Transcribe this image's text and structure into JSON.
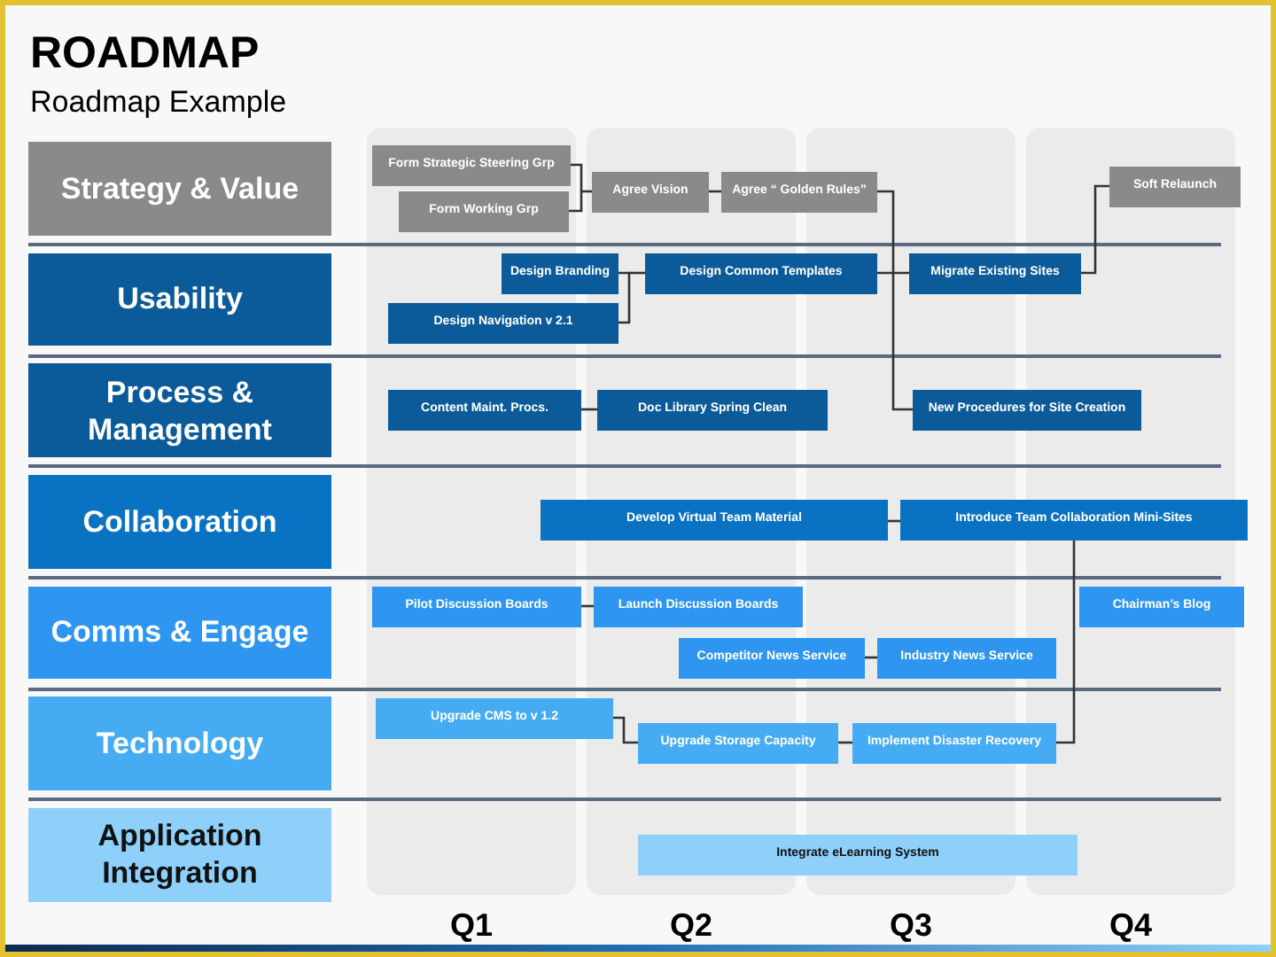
{
  "title": "ROADMAP",
  "subtitle": "Roadmap Example",
  "quarters": [
    "Q1",
    "Q2",
    "Q3",
    "Q4"
  ],
  "lanes": [
    {
      "label": "Strategy & Value",
      "color": "#8a8a8a",
      "tasks": [
        "Form Strategic Steering Grp",
        "Form Working Grp",
        "Agree Vision",
        "Agree “ Golden Rules”",
        "Soft Relaunch"
      ]
    },
    {
      "label": "Usability",
      "color": "#0b5a99",
      "tasks": [
        "Design Branding",
        "Design Navigation v 2.1",
        "Design Common Templates",
        "Migrate Existing Sites"
      ]
    },
    {
      "label": "Process & Management",
      "color": "#0b5a99",
      "tasks": [
        "Content Maint. Procs.",
        "Doc Library Spring Clean",
        "New Procedures for Site Creation"
      ]
    },
    {
      "label": "Collaboration",
      "color": "#0a72c2",
      "tasks": [
        "Develop Virtual Team Material",
        "Introduce Team Collaboration Mini-Sites"
      ]
    },
    {
      "label": "Comms & Engage",
      "color": "#2e96f0",
      "tasks": [
        "Pilot Discussion Boards",
        "Launch Discussion Boards",
        "Competitor News Service",
        "Industry News Service",
        "Chairman’s Blog"
      ]
    },
    {
      "label": "Technology",
      "color": "#45acf4",
      "tasks": [
        "Upgrade CMS to v 1.2",
        "Upgrade Storage Capacity",
        "Implement Disaster Recovery"
      ]
    },
    {
      "label": "Application Integration",
      "color": "#8fd0fa",
      "tasks": [
        "Integrate eLearning System"
      ]
    }
  ]
}
